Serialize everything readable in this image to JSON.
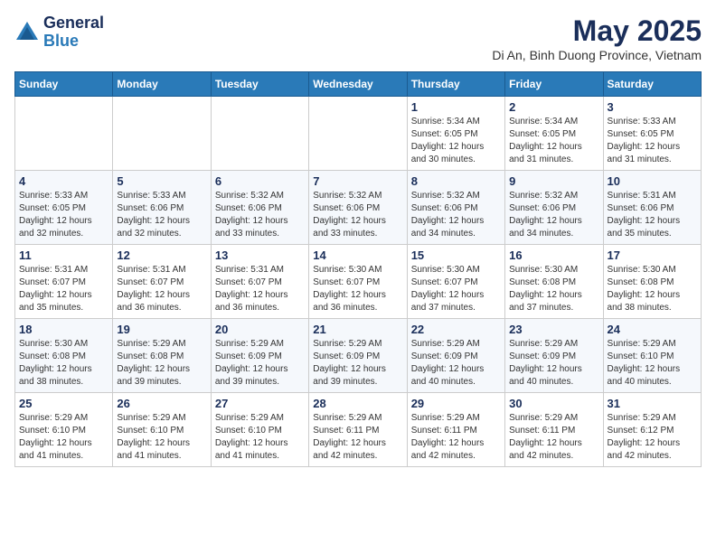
{
  "header": {
    "logo_general": "General",
    "logo_blue": "Blue",
    "month_title": "May 2025",
    "location": "Di An, Binh Duong Province, Vietnam"
  },
  "weekdays": [
    "Sunday",
    "Monday",
    "Tuesday",
    "Wednesday",
    "Thursday",
    "Friday",
    "Saturday"
  ],
  "weeks": [
    [
      {
        "day": "",
        "info": ""
      },
      {
        "day": "",
        "info": ""
      },
      {
        "day": "",
        "info": ""
      },
      {
        "day": "",
        "info": ""
      },
      {
        "day": "1",
        "info": "Sunrise: 5:34 AM\nSunset: 6:05 PM\nDaylight: 12 hours\nand 30 minutes."
      },
      {
        "day": "2",
        "info": "Sunrise: 5:34 AM\nSunset: 6:05 PM\nDaylight: 12 hours\nand 31 minutes."
      },
      {
        "day": "3",
        "info": "Sunrise: 5:33 AM\nSunset: 6:05 PM\nDaylight: 12 hours\nand 31 minutes."
      }
    ],
    [
      {
        "day": "4",
        "info": "Sunrise: 5:33 AM\nSunset: 6:05 PM\nDaylight: 12 hours\nand 32 minutes."
      },
      {
        "day": "5",
        "info": "Sunrise: 5:33 AM\nSunset: 6:06 PM\nDaylight: 12 hours\nand 32 minutes."
      },
      {
        "day": "6",
        "info": "Sunrise: 5:32 AM\nSunset: 6:06 PM\nDaylight: 12 hours\nand 33 minutes."
      },
      {
        "day": "7",
        "info": "Sunrise: 5:32 AM\nSunset: 6:06 PM\nDaylight: 12 hours\nand 33 minutes."
      },
      {
        "day": "8",
        "info": "Sunrise: 5:32 AM\nSunset: 6:06 PM\nDaylight: 12 hours\nand 34 minutes."
      },
      {
        "day": "9",
        "info": "Sunrise: 5:32 AM\nSunset: 6:06 PM\nDaylight: 12 hours\nand 34 minutes."
      },
      {
        "day": "10",
        "info": "Sunrise: 5:31 AM\nSunset: 6:06 PM\nDaylight: 12 hours\nand 35 minutes."
      }
    ],
    [
      {
        "day": "11",
        "info": "Sunrise: 5:31 AM\nSunset: 6:07 PM\nDaylight: 12 hours\nand 35 minutes."
      },
      {
        "day": "12",
        "info": "Sunrise: 5:31 AM\nSunset: 6:07 PM\nDaylight: 12 hours\nand 36 minutes."
      },
      {
        "day": "13",
        "info": "Sunrise: 5:31 AM\nSunset: 6:07 PM\nDaylight: 12 hours\nand 36 minutes."
      },
      {
        "day": "14",
        "info": "Sunrise: 5:30 AM\nSunset: 6:07 PM\nDaylight: 12 hours\nand 36 minutes."
      },
      {
        "day": "15",
        "info": "Sunrise: 5:30 AM\nSunset: 6:07 PM\nDaylight: 12 hours\nand 37 minutes."
      },
      {
        "day": "16",
        "info": "Sunrise: 5:30 AM\nSunset: 6:08 PM\nDaylight: 12 hours\nand 37 minutes."
      },
      {
        "day": "17",
        "info": "Sunrise: 5:30 AM\nSunset: 6:08 PM\nDaylight: 12 hours\nand 38 minutes."
      }
    ],
    [
      {
        "day": "18",
        "info": "Sunrise: 5:30 AM\nSunset: 6:08 PM\nDaylight: 12 hours\nand 38 minutes."
      },
      {
        "day": "19",
        "info": "Sunrise: 5:29 AM\nSunset: 6:08 PM\nDaylight: 12 hours\nand 39 minutes."
      },
      {
        "day": "20",
        "info": "Sunrise: 5:29 AM\nSunset: 6:09 PM\nDaylight: 12 hours\nand 39 minutes."
      },
      {
        "day": "21",
        "info": "Sunrise: 5:29 AM\nSunset: 6:09 PM\nDaylight: 12 hours\nand 39 minutes."
      },
      {
        "day": "22",
        "info": "Sunrise: 5:29 AM\nSunset: 6:09 PM\nDaylight: 12 hours\nand 40 minutes."
      },
      {
        "day": "23",
        "info": "Sunrise: 5:29 AM\nSunset: 6:09 PM\nDaylight: 12 hours\nand 40 minutes."
      },
      {
        "day": "24",
        "info": "Sunrise: 5:29 AM\nSunset: 6:10 PM\nDaylight: 12 hours\nand 40 minutes."
      }
    ],
    [
      {
        "day": "25",
        "info": "Sunrise: 5:29 AM\nSunset: 6:10 PM\nDaylight: 12 hours\nand 41 minutes."
      },
      {
        "day": "26",
        "info": "Sunrise: 5:29 AM\nSunset: 6:10 PM\nDaylight: 12 hours\nand 41 minutes."
      },
      {
        "day": "27",
        "info": "Sunrise: 5:29 AM\nSunset: 6:10 PM\nDaylight: 12 hours\nand 41 minutes."
      },
      {
        "day": "28",
        "info": "Sunrise: 5:29 AM\nSunset: 6:11 PM\nDaylight: 12 hours\nand 42 minutes."
      },
      {
        "day": "29",
        "info": "Sunrise: 5:29 AM\nSunset: 6:11 PM\nDaylight: 12 hours\nand 42 minutes."
      },
      {
        "day": "30",
        "info": "Sunrise: 5:29 AM\nSunset: 6:11 PM\nDaylight: 12 hours\nand 42 minutes."
      },
      {
        "day": "31",
        "info": "Sunrise: 5:29 AM\nSunset: 6:12 PM\nDaylight: 12 hours\nand 42 minutes."
      }
    ]
  ]
}
